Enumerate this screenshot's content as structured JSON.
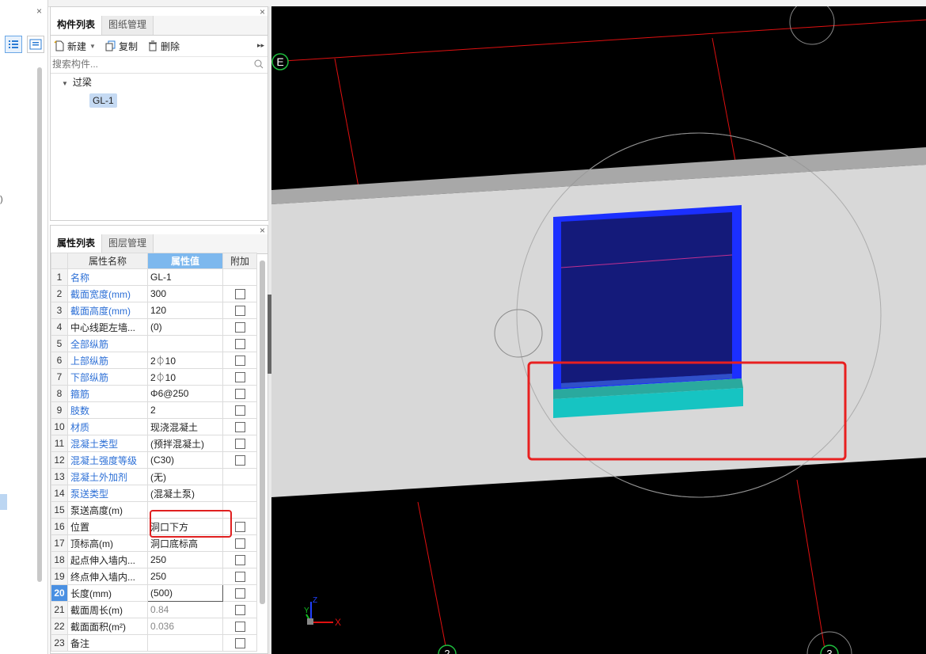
{
  "component_panel": {
    "tabs": [
      "构件列表",
      "图纸管理"
    ],
    "toolbar": {
      "new": "新建",
      "copy": "复制",
      "delete": "删除"
    },
    "search_placeholder": "搜索构件...",
    "tree": {
      "group": "过梁",
      "item": "GL-1"
    }
  },
  "property_panel": {
    "tabs": [
      "属性列表",
      "图层管理"
    ],
    "headers": {
      "name": "属性名称",
      "value": "属性值",
      "extra": "附加"
    },
    "rows": [
      {
        "num": "1",
        "name": "名称",
        "value": "GL-1",
        "blue": true,
        "check": false
      },
      {
        "num": "2",
        "name": "截面宽度(mm)",
        "value": "300",
        "blue": true,
        "check": true
      },
      {
        "num": "3",
        "name": "截面高度(mm)",
        "value": "120",
        "blue": true,
        "check": true
      },
      {
        "num": "4",
        "name": "中心线距左墙...",
        "value": "(0)",
        "blue": false,
        "check": true
      },
      {
        "num": "5",
        "name": "全部纵筋",
        "value": "",
        "blue": true,
        "check": true
      },
      {
        "num": "6",
        "name": "上部纵筋",
        "value": "2⏀10",
        "blue": true,
        "check": true
      },
      {
        "num": "7",
        "name": "下部纵筋",
        "value": "2⏀10",
        "blue": true,
        "check": true
      },
      {
        "num": "8",
        "name": "箍筋",
        "value": "Φ6@250",
        "blue": true,
        "check": true
      },
      {
        "num": "9",
        "name": "肢数",
        "value": "2",
        "blue": true,
        "check": true
      },
      {
        "num": "10",
        "name": "材质",
        "value": "现浇混凝土",
        "blue": true,
        "check": true
      },
      {
        "num": "11",
        "name": "混凝土类型",
        "value": "(预拌混凝土)",
        "blue": true,
        "check": true
      },
      {
        "num": "12",
        "name": "混凝土强度等级",
        "value": "(C30)",
        "blue": true,
        "check": true
      },
      {
        "num": "13",
        "name": "混凝土外加剂",
        "value": "(无)",
        "blue": true,
        "check": false
      },
      {
        "num": "14",
        "name": "泵送类型",
        "value": "(混凝土泵)",
        "blue": true,
        "check": false
      },
      {
        "num": "15",
        "name": "泵送高度(m)",
        "value": "",
        "blue": false,
        "check": false
      },
      {
        "num": "16",
        "name": "位置",
        "value": "洞口下方",
        "blue": false,
        "check": true
      },
      {
        "num": "17",
        "name": "顶标高(m)",
        "value": "洞口底标高",
        "blue": false,
        "check": true
      },
      {
        "num": "18",
        "name": "起点伸入墙内...",
        "value": "250",
        "blue": false,
        "check": true
      },
      {
        "num": "19",
        "name": "终点伸入墙内...",
        "value": "250",
        "blue": false,
        "check": true
      },
      {
        "num": "20",
        "name": "长度(mm)",
        "value": "(500)",
        "blue": false,
        "check": true
      },
      {
        "num": "21",
        "name": "截面周长(m)",
        "value": "0.84",
        "blue": false,
        "check": true
      },
      {
        "num": "22",
        "name": "截面面积(m²)",
        "value": "0.036",
        "blue": false,
        "check": true
      },
      {
        "num": "23",
        "name": "备注",
        "value": "",
        "blue": false,
        "check": true
      }
    ]
  },
  "viewport": {
    "axis_labels": {
      "e": "E",
      "two": "2",
      "three": "3"
    },
    "gizmo": {
      "x": "X",
      "y": "Y",
      "z": "Z"
    }
  }
}
